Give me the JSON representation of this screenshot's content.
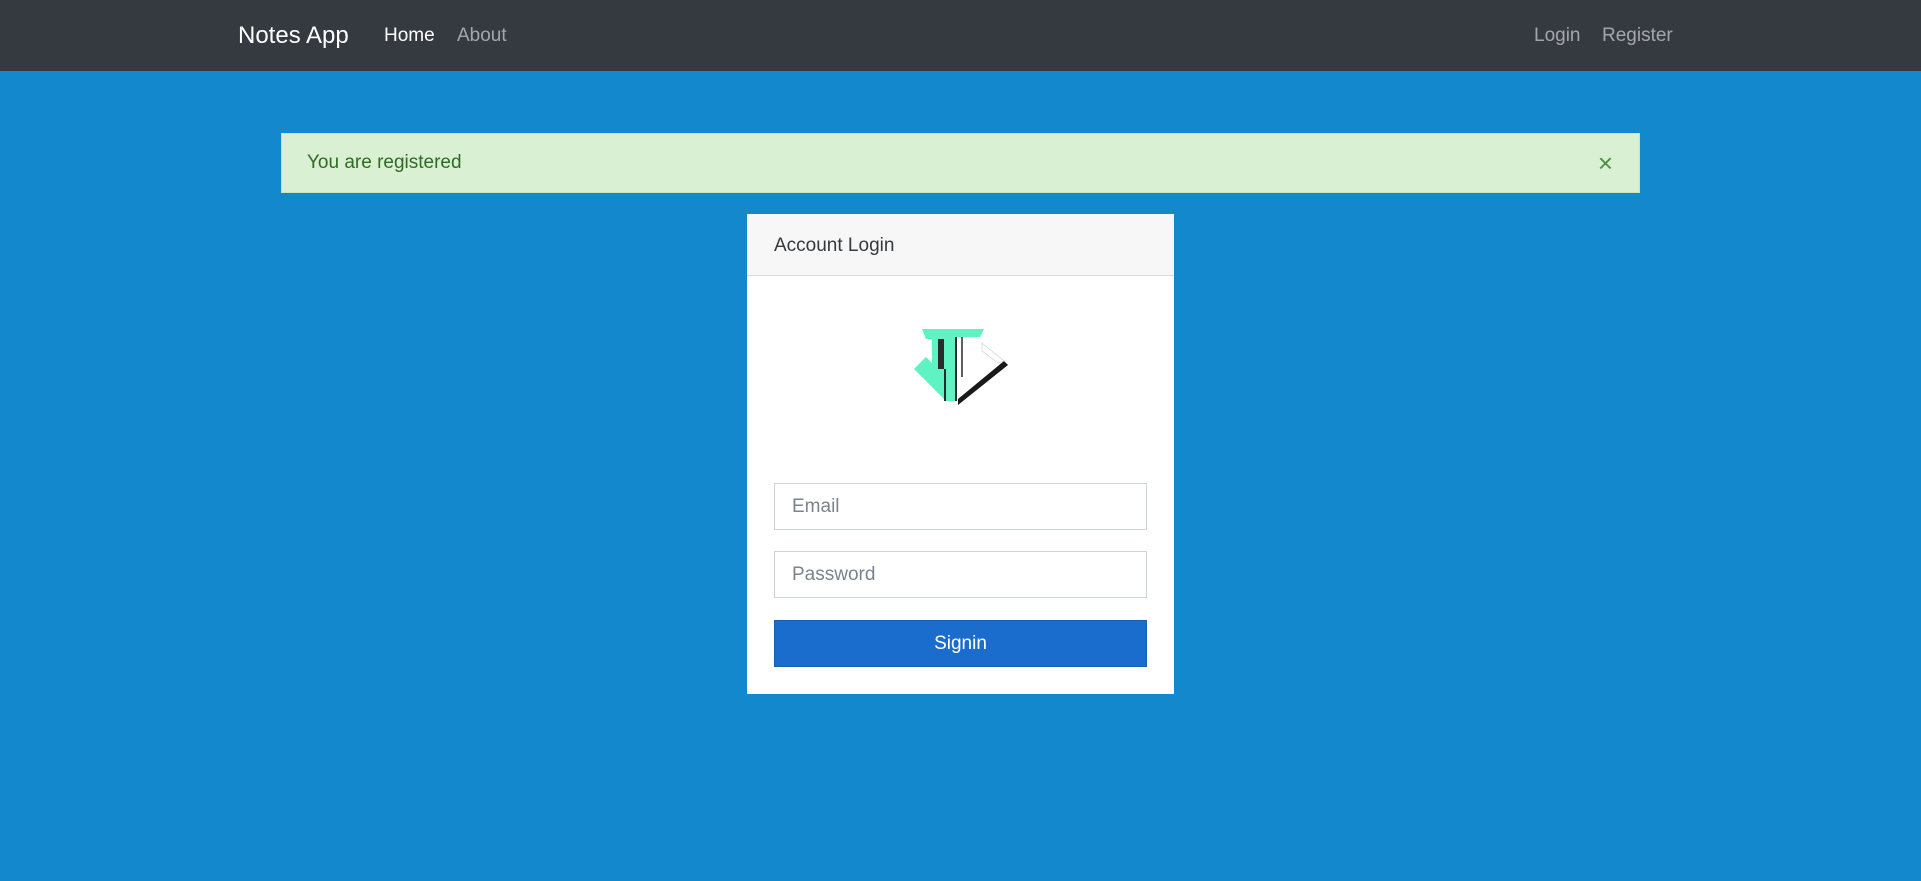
{
  "navbar": {
    "brand": "Notes App",
    "links": [
      {
        "label": "Home"
      },
      {
        "label": "About"
      }
    ],
    "auth_links": [
      {
        "label": "Login"
      },
      {
        "label": "Register"
      }
    ]
  },
  "alert": {
    "message": "You are registered",
    "close_symbol": "×"
  },
  "login_card": {
    "title": "Account Login",
    "logo_icon": "logo-icon",
    "email_placeholder": "Email",
    "password_placeholder": "Password",
    "submit_label": "Signin"
  },
  "colors": {
    "navbar_bg": "#343a40",
    "page_bg": "#1488cc",
    "alert_bg": "#d9f0d2",
    "button_bg": "#1a6dcd",
    "logo_accent": "#5ff2c2"
  }
}
